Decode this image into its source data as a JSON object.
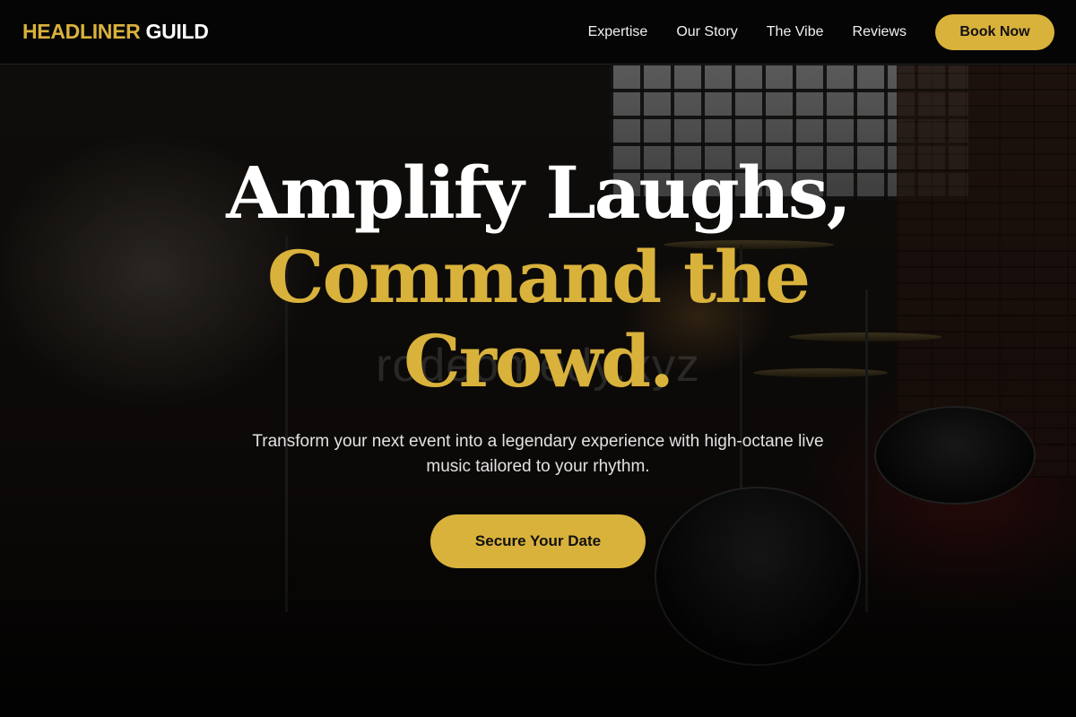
{
  "header": {
    "logo_primary": "HEADLINER",
    "logo_secondary": "GUILD",
    "nav": [
      {
        "label": "Expertise"
      },
      {
        "label": "Our Story"
      },
      {
        "label": "The Vibe"
      },
      {
        "label": "Reviews"
      }
    ],
    "cta_label": "Book Now"
  },
  "hero": {
    "headline_line1": "Amplify Laughs,",
    "headline_line2a": "Command the",
    "headline_line2b": "Crowd.",
    "watermark": "rodeomedy.xyz",
    "subtext": "Transform your next event into a legendary experience with high-octane live music tailored to your rhythm.",
    "cta_label": "Secure Your Date"
  },
  "colors": {
    "accent": "#d9b23c",
    "header_bg": "#050505",
    "text": "#ffffff"
  }
}
